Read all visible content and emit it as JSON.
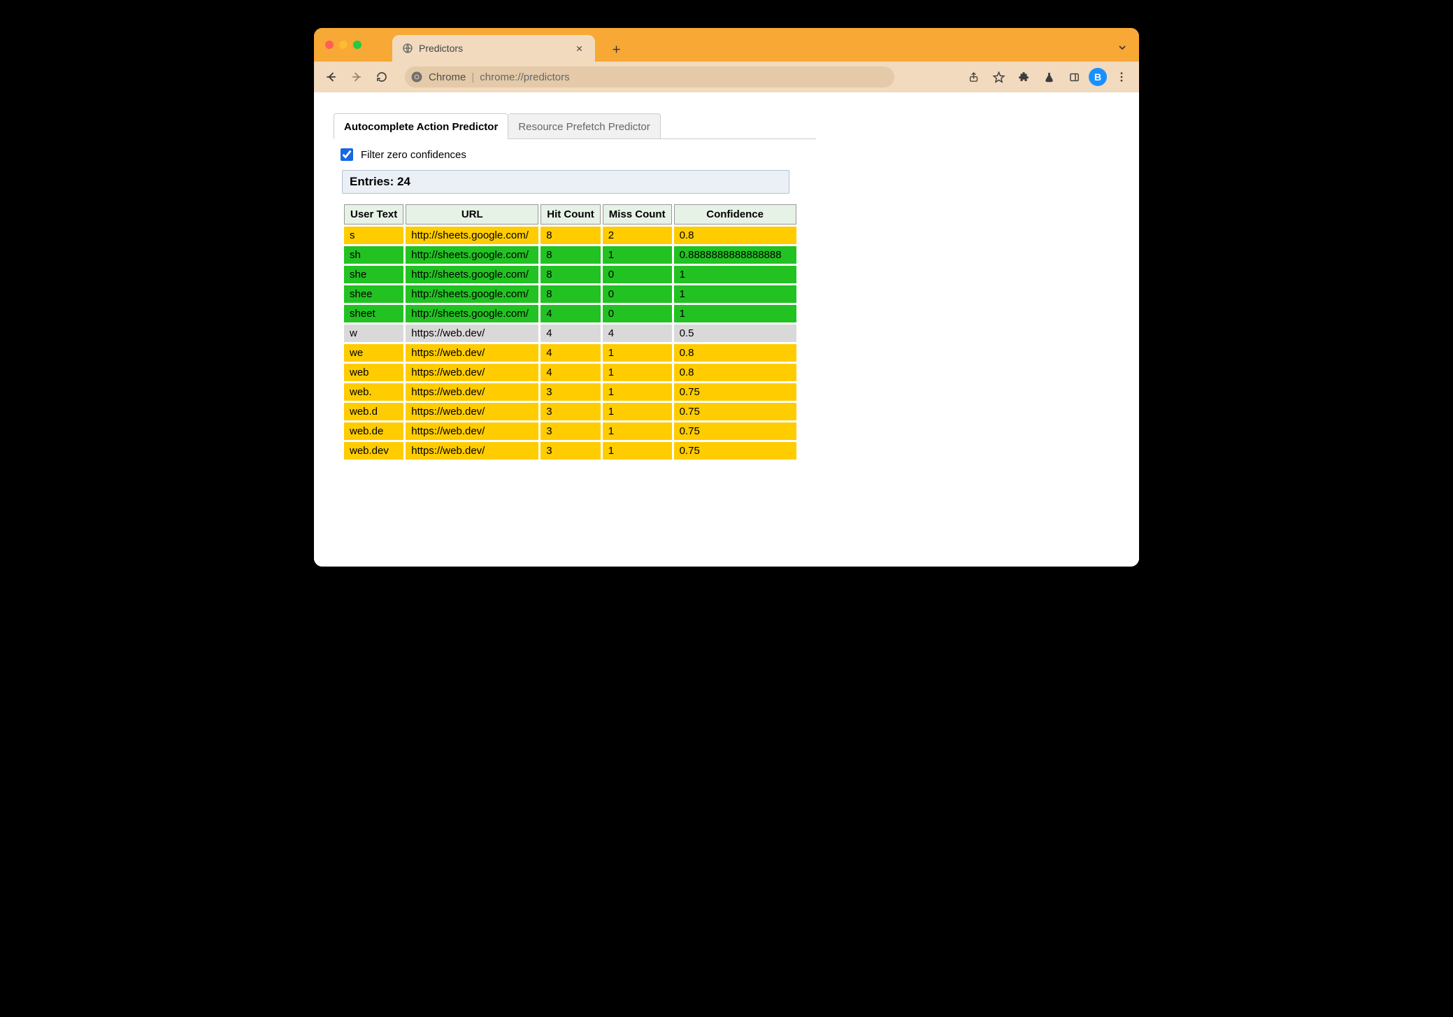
{
  "browser": {
    "tab_title": "Predictors",
    "address_prefix": "Chrome",
    "address_url": "chrome://predictors",
    "avatar_letter": "B"
  },
  "page": {
    "tabs": {
      "active": "Autocomplete Action Predictor",
      "inactive": "Resource Prefetch Predictor"
    },
    "filter_label": "Filter zero confidences",
    "filter_checked": true,
    "entry_count_label": "Entries: 24",
    "columns": [
      "User Text",
      "URL",
      "Hit Count",
      "Miss Count",
      "Confidence"
    ],
    "rows": [
      {
        "user_text": "s",
        "url": "http://sheets.google.com/",
        "hit": "8",
        "miss": "2",
        "conf": "0.8",
        "cls": "yellow"
      },
      {
        "user_text": "sh",
        "url": "http://sheets.google.com/",
        "hit": "8",
        "miss": "1",
        "conf": "0.8888888888888888",
        "cls": "green"
      },
      {
        "user_text": "she",
        "url": "http://sheets.google.com/",
        "hit": "8",
        "miss": "0",
        "conf": "1",
        "cls": "green"
      },
      {
        "user_text": "shee",
        "url": "http://sheets.google.com/",
        "hit": "8",
        "miss": "0",
        "conf": "1",
        "cls": "green"
      },
      {
        "user_text": "sheet",
        "url": "http://sheets.google.com/",
        "hit": "4",
        "miss": "0",
        "conf": "1",
        "cls": "green"
      },
      {
        "user_text": "w",
        "url": "https://web.dev/",
        "hit": "4",
        "miss": "4",
        "conf": "0.5",
        "cls": "grey"
      },
      {
        "user_text": "we",
        "url": "https://web.dev/",
        "hit": "4",
        "miss": "1",
        "conf": "0.8",
        "cls": "yellow"
      },
      {
        "user_text": "web",
        "url": "https://web.dev/",
        "hit": "4",
        "miss": "1",
        "conf": "0.8",
        "cls": "yellow"
      },
      {
        "user_text": "web.",
        "url": "https://web.dev/",
        "hit": "3",
        "miss": "1",
        "conf": "0.75",
        "cls": "yellow"
      },
      {
        "user_text": "web.d",
        "url": "https://web.dev/",
        "hit": "3",
        "miss": "1",
        "conf": "0.75",
        "cls": "yellow"
      },
      {
        "user_text": "web.de",
        "url": "https://web.dev/",
        "hit": "3",
        "miss": "1",
        "conf": "0.75",
        "cls": "yellow"
      },
      {
        "user_text": "web.dev",
        "url": "https://web.dev/",
        "hit": "3",
        "miss": "1",
        "conf": "0.75",
        "cls": "yellow"
      }
    ]
  }
}
